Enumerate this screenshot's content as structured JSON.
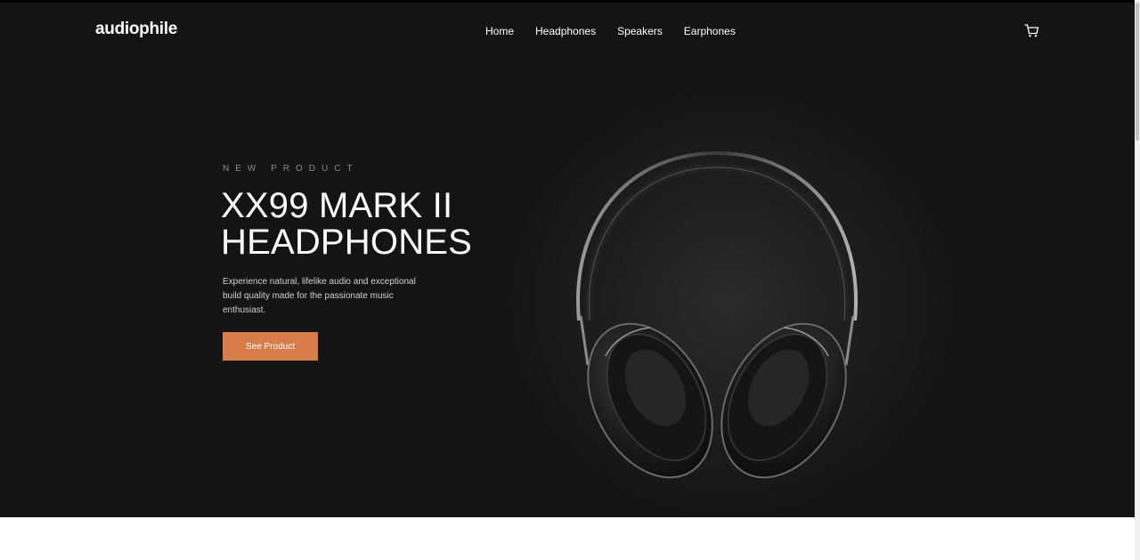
{
  "header": {
    "logo": "audiophile",
    "nav": [
      "Home",
      "Headphones",
      "Speakers",
      "Earphones"
    ],
    "cart_icon": "cart-icon"
  },
  "hero": {
    "eyebrow": "NEW PRODUCT",
    "title_line1": "XX99 MARK II",
    "title_line2": "HEADPHONES",
    "description": "Experience natural, lifelike audio and exceptional build quality made for the passionate music enthusiast.",
    "cta_label": "See Product",
    "image_icon": "headphones-image"
  },
  "colors": {
    "hero_bg": "#141414",
    "accent": "#d87d4a",
    "text": "#ffffff"
  }
}
